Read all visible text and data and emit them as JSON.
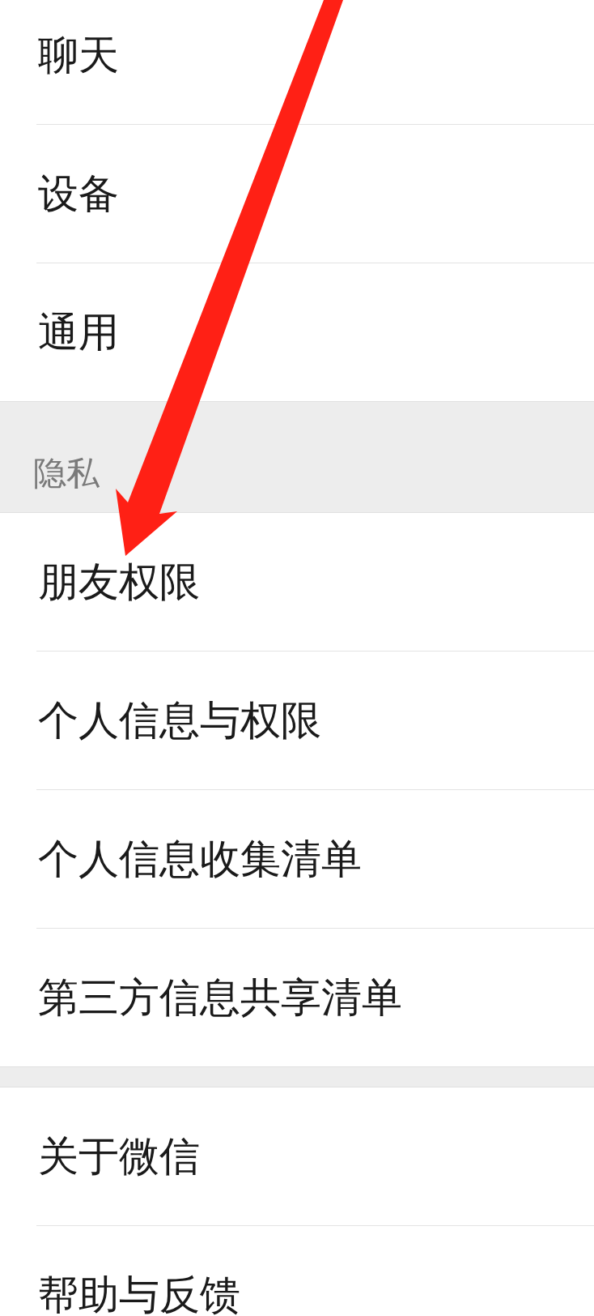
{
  "sections": [
    {
      "items": [
        "聊天",
        "设备",
        "通用"
      ]
    },
    {
      "header": "隐私",
      "items": [
        "朋友权限",
        "个人信息与权限",
        "个人信息收集清单",
        "第三方信息共享清单"
      ]
    },
    {
      "items": [
        "关于微信",
        "帮助与反馈"
      ]
    }
  ]
}
